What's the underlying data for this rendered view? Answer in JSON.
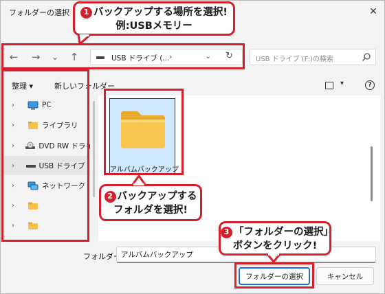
{
  "window": {
    "title": "フォルダーの選択",
    "close_glyph": "✕"
  },
  "nav": {
    "back_glyph": "←",
    "forward_glyph": "→",
    "recent_glyph": "⌄",
    "up_glyph": "↑",
    "address_text": "USB ドライブ (...",
    "address_sep": "›",
    "address_dropdown": "⌄",
    "refresh_glyph": "↻",
    "search_placeholder": "USB ドライブ (F:)の検索"
  },
  "commands": {
    "organize": "整理 ▾",
    "new_folder": "新しいフォルダー",
    "view_dropdown": "▾",
    "help": "?"
  },
  "sidebar": {
    "items": [
      {
        "label": "PC",
        "icon": "pc-icon"
      },
      {
        "label": "ライブラリ",
        "icon": "library-icon"
      },
      {
        "label": "DVD RW ドライブ",
        "icon": "dvd-drive-icon"
      },
      {
        "label": "USB ドライブ (F:)",
        "icon": "usb-drive-icon",
        "selected": true
      },
      {
        "label": "ネットワーク",
        "icon": "network-icon"
      },
      {
        "label": "",
        "icon": "folder-icon"
      },
      {
        "label": "",
        "icon": "folder-icon"
      }
    ],
    "chevron": "›"
  },
  "content": {
    "folders": [
      {
        "name": "アルバムバックアップ"
      }
    ]
  },
  "footer": {
    "folder_label": "フォルダー:",
    "folder_value": "アルバムバックアップ",
    "select_button": "フォルダーの選択",
    "cancel_button": "キャンセル"
  },
  "callouts": {
    "c1": {
      "num": "1",
      "line1": "バックアップする場所を選択!",
      "line2": "例:USBメモリー"
    },
    "c2": {
      "num": "2",
      "line1": "バックアップする",
      "line2": "フォルダを選択!"
    },
    "c3": {
      "num": "3",
      "line1": "「フォルダーの選択」",
      "line2": "ボタンをクリック!"
    }
  },
  "colors": {
    "accent": "#1f6fd1",
    "callout_red": "#d4202c",
    "selection": "#cde8ff",
    "folder": "#f9c74f"
  }
}
